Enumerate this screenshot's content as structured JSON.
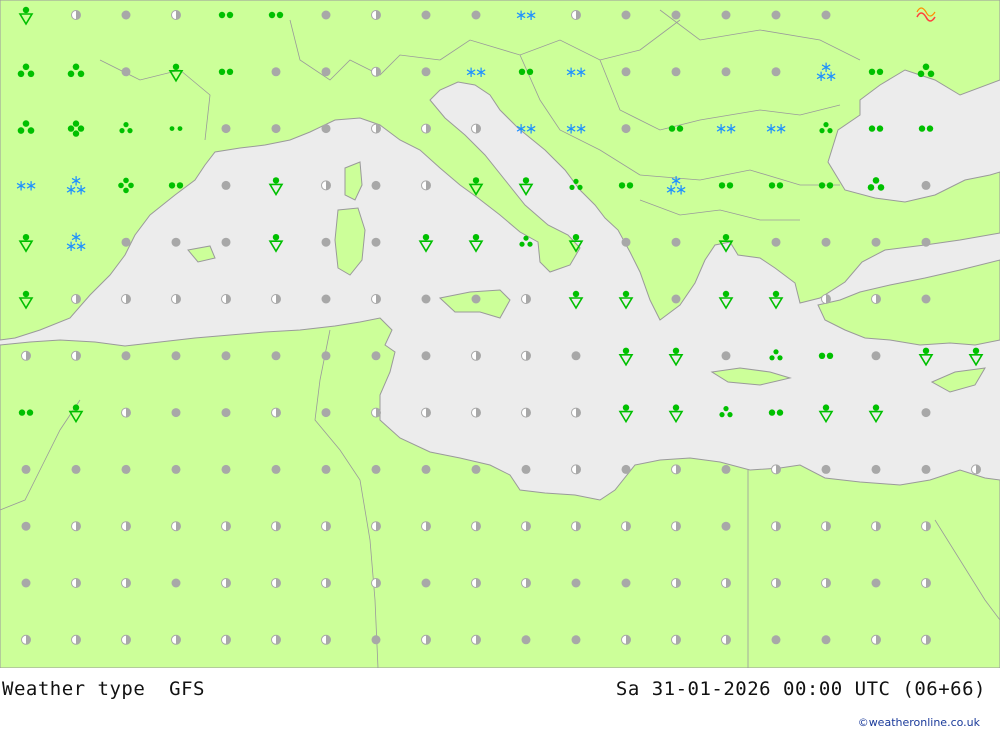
{
  "title": "Weather type",
  "model": "GFS",
  "datetime": "Sa 31-01-2026 00:00 UTC (06+66)",
  "credit": "©weatheronline.co.uk",
  "colors": {
    "sea": "#ececec",
    "land": "#ccff99",
    "border": "#9a9a9a",
    "precip": "#00c000",
    "snow": "#1e90ff",
    "cloud": "#a8a8a8",
    "fog": "#ff4040"
  },
  "grid": {
    "rows": [
      "R..h..o.hrr.oh.o.o.S.h.o.o.o.o.o.OW",
      "T.T.o.R.r.o.o.h.o.S.r.S.o.o.o.o.Q.r.T",
      "T.D.t.k.o.o.o.h.h.h.S.S.o.r.S.S.t.r.r",
      "S.Q.d.r.o.R.h.o.h.R.R.t.r.Q.r.r.r.T.o",
      "R.Q.o.o.o.R.o.o.R.R.t.R.o.o.R.o.o.o.o",
      "R.h.h.h.h.h.o.h.o.o.h.R.R.o.R.R.h.h.o",
      "h.h.o.o.o.o.o.o.o.h.h.o.R.R.o.t.r.o.R.R",
      "r.R.h.o.o.h.o.h.h.h.h.h.R.R.t.r.R.R.o",
      "o.o.o.o.o.o.o.o.o.o.o.h.o.h.o.h.o.o.o.h",
      "o.h.h.h.h.h.h.h.h.h.h.h.h.h.o.h.h.h.h",
      "o.h.h.o.h.h.h.h.o.h.h.o.o.h.h.h.h.o.h",
      "h.h.h.h.h.h.h.o.h.h.o.o.h.h.h.o.o.h.h"
    ],
    "legend_codes": {
      "o": "overcast",
      "h": "partly cloudy",
      ".": "clear",
      "r": "rain",
      "R": "rain showers",
      "T": "thunder showers",
      "t": "thunder",
      "D": "thunder",
      "d": "thunder",
      "k": "light rain",
      "S": "snow",
      "Q": "snow showers",
      "W": "fog"
    }
  }
}
